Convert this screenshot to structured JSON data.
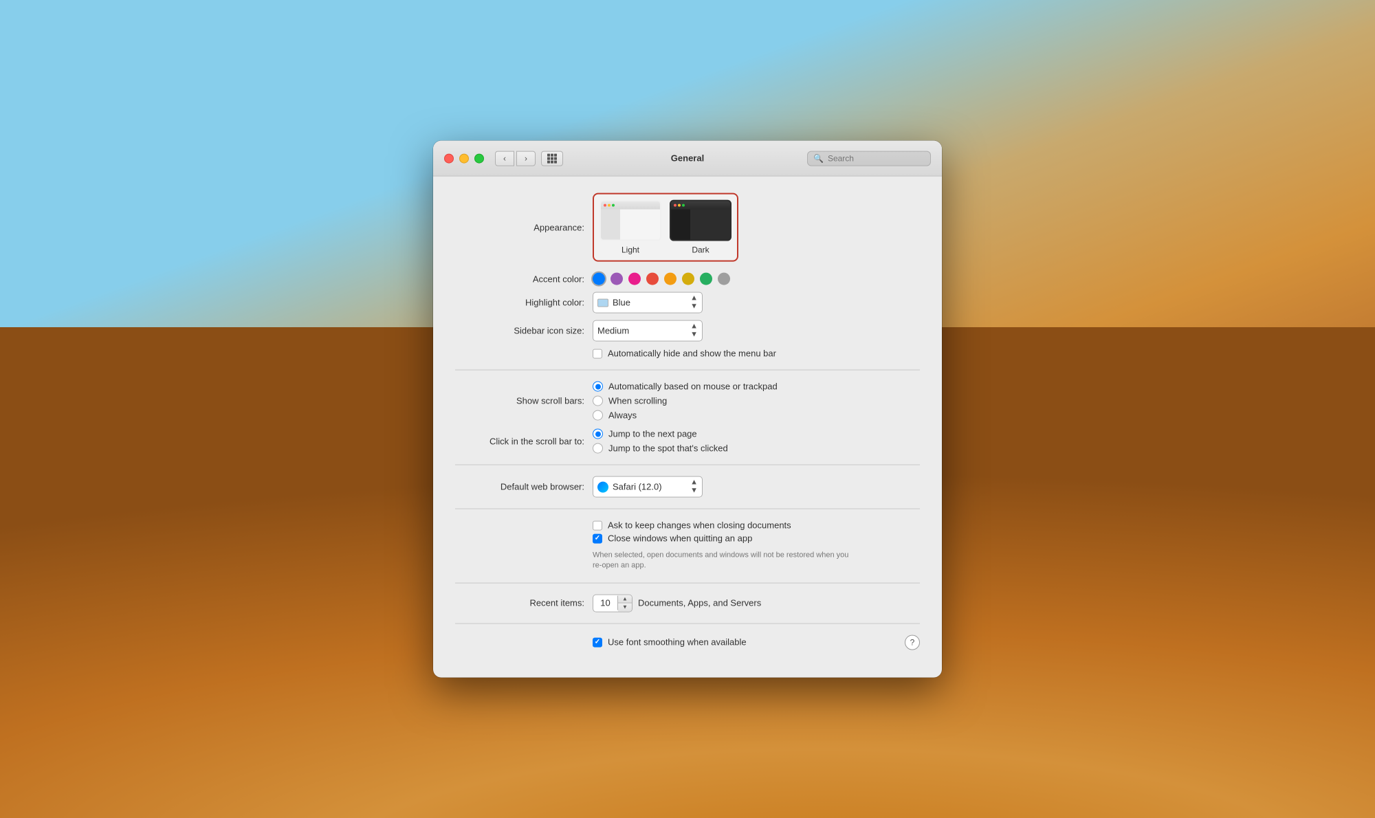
{
  "desktop": {
    "background": "macOS Mojave desert"
  },
  "window": {
    "title": "General",
    "traffic_lights": {
      "close": "close",
      "minimize": "minimize",
      "zoom": "zoom"
    },
    "nav": {
      "back_label": "‹",
      "forward_label": "›"
    },
    "search": {
      "placeholder": "Search",
      "value": ""
    }
  },
  "appearance": {
    "label": "Appearance:",
    "options": [
      {
        "id": "light",
        "label": "Light",
        "selected": false
      },
      {
        "id": "dark",
        "label": "Dark",
        "selected": true
      }
    ]
  },
  "accent_color": {
    "label": "Accent color:",
    "colors": [
      {
        "id": "blue",
        "hex": "#007aff",
        "selected": true
      },
      {
        "id": "purple",
        "hex": "#9b59b6",
        "selected": false
      },
      {
        "id": "pink",
        "hex": "#e91e8c",
        "selected": false
      },
      {
        "id": "red",
        "hex": "#e74c3c",
        "selected": false
      },
      {
        "id": "orange",
        "hex": "#f39c12",
        "selected": false
      },
      {
        "id": "yellow",
        "hex": "#d4ac0d",
        "selected": false
      },
      {
        "id": "green",
        "hex": "#27ae60",
        "selected": false
      },
      {
        "id": "graphite",
        "hex": "#9e9e9e",
        "selected": false
      }
    ]
  },
  "highlight_color": {
    "label": "Highlight color:",
    "value": "Blue",
    "swatch": "#aed6f1"
  },
  "sidebar_icon_size": {
    "label": "Sidebar icon size:",
    "value": "Medium"
  },
  "menu_bar": {
    "label": "",
    "checkbox_label": "Automatically hide and show the menu bar",
    "checked": false
  },
  "show_scroll_bars": {
    "label": "Show scroll bars:",
    "options": [
      {
        "id": "auto",
        "label": "Automatically based on mouse or trackpad",
        "selected": true
      },
      {
        "id": "scrolling",
        "label": "When scrolling",
        "selected": false
      },
      {
        "id": "always",
        "label": "Always",
        "selected": false
      }
    ]
  },
  "click_scroll_bar": {
    "label": "Click in the scroll bar to:",
    "options": [
      {
        "id": "next_page",
        "label": "Jump to the next page",
        "selected": true
      },
      {
        "id": "spot",
        "label": "Jump to the spot that's clicked",
        "selected": false
      }
    ]
  },
  "default_browser": {
    "label": "Default web browser:",
    "value": "Safari (12.0)"
  },
  "document_options": {
    "ask_changes": {
      "label": "Ask to keep changes when closing documents",
      "checked": false
    },
    "close_windows": {
      "label": "Close windows when quitting an app",
      "checked": true
    },
    "subtext": "When selected, open documents and windows will not be restored when you re-open an app."
  },
  "recent_items": {
    "label": "Recent items:",
    "value": "10",
    "suffix": "Documents, Apps, and Servers"
  },
  "font_smoothing": {
    "label": "Use font smoothing when available",
    "checked": true
  },
  "help": {
    "label": "?"
  }
}
